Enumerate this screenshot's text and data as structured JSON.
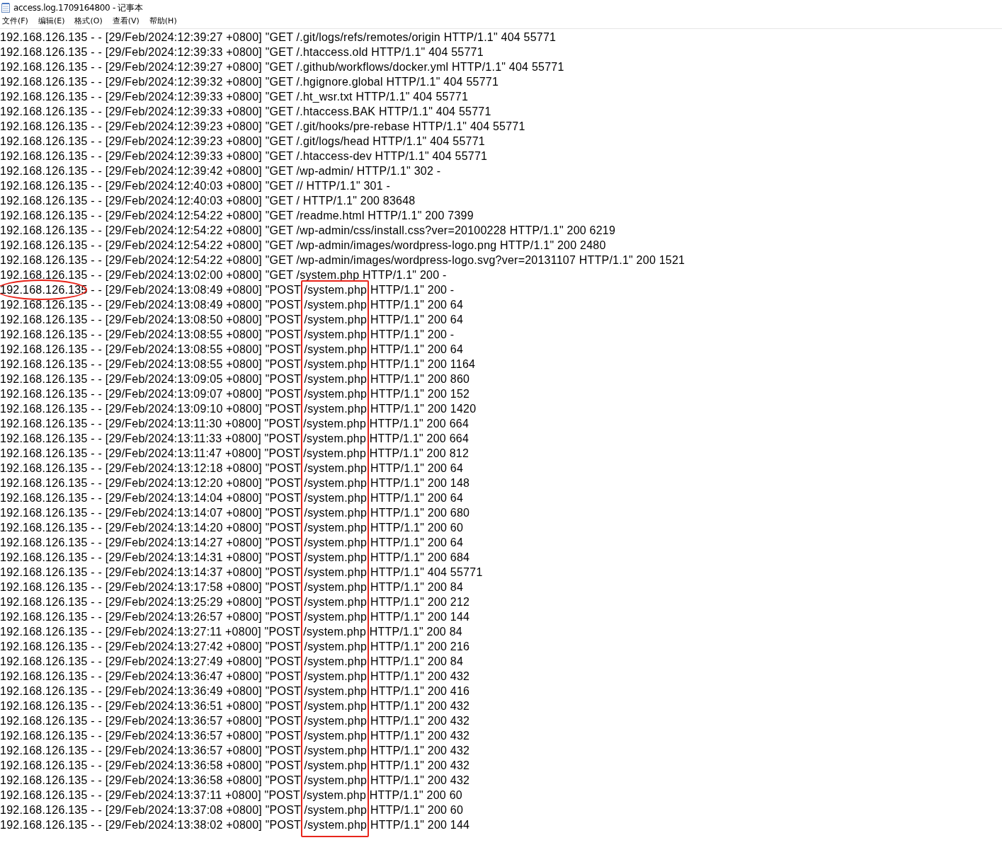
{
  "window": {
    "title": "access.log.1709164800 - 记事本"
  },
  "menu": [
    "文件(F)",
    "编辑(E)",
    "格式(O)",
    "查看(V)",
    "帮助(H)"
  ],
  "lines": [
    "192.168.126.135 - - [29/Feb/2024:12:39:27 +0800] \"GET /.git/logs/refs/remotes/origin HTTP/1.1\" 404 55771",
    "192.168.126.135 - - [29/Feb/2024:12:39:33 +0800] \"GET /.htaccess.old HTTP/1.1\" 404 55771",
    "192.168.126.135 - - [29/Feb/2024:12:39:27 +0800] \"GET /.github/workflows/docker.yml HTTP/1.1\" 404 55771",
    "192.168.126.135 - - [29/Feb/2024:12:39:32 +0800] \"GET /.hgignore.global HTTP/1.1\" 404 55771",
    "192.168.126.135 - - [29/Feb/2024:12:39:33 +0800] \"GET /.ht_wsr.txt HTTP/1.1\" 404 55771",
    "192.168.126.135 - - [29/Feb/2024:12:39:33 +0800] \"GET /.htaccess.BAK HTTP/1.1\" 404 55771",
    "192.168.126.135 - - [29/Feb/2024:12:39:23 +0800] \"GET /.git/hooks/pre-rebase HTTP/1.1\" 404 55771",
    "192.168.126.135 - - [29/Feb/2024:12:39:23 +0800] \"GET /.git/logs/head HTTP/1.1\" 404 55771",
    "192.168.126.135 - - [29/Feb/2024:12:39:33 +0800] \"GET /.htaccess-dev HTTP/1.1\" 404 55771",
    "192.168.126.135 - - [29/Feb/2024:12:39:42 +0800] \"GET /wp-admin/ HTTP/1.1\" 302 -",
    "192.168.126.135 - - [29/Feb/2024:12:40:03 +0800] \"GET // HTTP/1.1\" 301 -",
    "192.168.126.135 - - [29/Feb/2024:12:40:03 +0800] \"GET / HTTP/1.1\" 200 83648",
    "192.168.126.135 - - [29/Feb/2024:12:54:22 +0800] \"GET /readme.html HTTP/1.1\" 200 7399",
    "192.168.126.135 - - [29/Feb/2024:12:54:22 +0800] \"GET /wp-admin/css/install.css?ver=20100228 HTTP/1.1\" 200 6219",
    "192.168.126.135 - - [29/Feb/2024:12:54:22 +0800] \"GET /wp-admin/images/wordpress-logo.png HTTP/1.1\" 200 2480",
    "192.168.126.135 - - [29/Feb/2024:12:54:22 +0800] \"GET /wp-admin/images/wordpress-logo.svg?ver=20131107 HTTP/1.1\" 200 1521",
    "192.168.126.135 - - [29/Feb/2024:13:02:00 +0800] \"GET /system.php HTTP/1.1\" 200 -",
    "192.168.126.135 - - [29/Feb/2024:13:08:49 +0800] \"POST /system.php HTTP/1.1\" 200 -",
    "192.168.126.135 - - [29/Feb/2024:13:08:49 +0800] \"POST /system.php HTTP/1.1\" 200 64",
    "192.168.126.135 - - [29/Feb/2024:13:08:50 +0800] \"POST /system.php HTTP/1.1\" 200 64",
    "192.168.126.135 - - [29/Feb/2024:13:08:55 +0800] \"POST /system.php HTTP/1.1\" 200 -",
    "192.168.126.135 - - [29/Feb/2024:13:08:55 +0800] \"POST /system.php HTTP/1.1\" 200 64",
    "192.168.126.135 - - [29/Feb/2024:13:08:55 +0800] \"POST /system.php HTTP/1.1\" 200 1164",
    "192.168.126.135 - - [29/Feb/2024:13:09:05 +0800] \"POST /system.php HTTP/1.1\" 200 860",
    "192.168.126.135 - - [29/Feb/2024:13:09:07 +0800] \"POST /system.php HTTP/1.1\" 200 152",
    "192.168.126.135 - - [29/Feb/2024:13:09:10 +0800] \"POST /system.php HTTP/1.1\" 200 1420",
    "192.168.126.135 - - [29/Feb/2024:13:11:30 +0800] \"POST /system.php HTTP/1.1\" 200 664",
    "192.168.126.135 - - [29/Feb/2024:13:11:33 +0800] \"POST /system.php HTTP/1.1\" 200 664",
    "192.168.126.135 - - [29/Feb/2024:13:11:47 +0800] \"POST /system.php HTTP/1.1\" 200 812",
    "192.168.126.135 - - [29/Feb/2024:13:12:18 +0800] \"POST /system.php HTTP/1.1\" 200 64",
    "192.168.126.135 - - [29/Feb/2024:13:12:20 +0800] \"POST /system.php HTTP/1.1\" 200 148",
    "192.168.126.135 - - [29/Feb/2024:13:14:04 +0800] \"POST /system.php HTTP/1.1\" 200 64",
    "192.168.126.135 - - [29/Feb/2024:13:14:07 +0800] \"POST /system.php HTTP/1.1\" 200 680",
    "192.168.126.135 - - [29/Feb/2024:13:14:20 +0800] \"POST /system.php HTTP/1.1\" 200 60",
    "192.168.126.135 - - [29/Feb/2024:13:14:27 +0800] \"POST /system.php HTTP/1.1\" 200 64",
    "192.168.126.135 - - [29/Feb/2024:13:14:31 +0800] \"POST /system.php HTTP/1.1\" 200 684",
    "192.168.126.135 - - [29/Feb/2024:13:14:37 +0800] \"POST /system.php HTTP/1.1\" 404 55771",
    "192.168.126.135 - - [29/Feb/2024:13:17:58 +0800] \"POST /system.php HTTP/1.1\" 200 84",
    "192.168.126.135 - - [29/Feb/2024:13:25:29 +0800] \"POST /system.php HTTP/1.1\" 200 212",
    "192.168.126.135 - - [29/Feb/2024:13:26:57 +0800] \"POST /system.php HTTP/1.1\" 200 144",
    "192.168.126.135 - - [29/Feb/2024:13:27:11 +0800] \"POST /system.php HTTP/1.1\" 200 84",
    "192.168.126.135 - - [29/Feb/2024:13:27:42 +0800] \"POST /system.php HTTP/1.1\" 200 216",
    "192.168.126.135 - - [29/Feb/2024:13:27:49 +0800] \"POST /system.php HTTP/1.1\" 200 84",
    "192.168.126.135 - - [29/Feb/2024:13:36:47 +0800] \"POST /system.php HTTP/1.1\" 200 432",
    "192.168.126.135 - - [29/Feb/2024:13:36:49 +0800] \"POST /system.php HTTP/1.1\" 200 416",
    "192.168.126.135 - - [29/Feb/2024:13:36:51 +0800] \"POST /system.php HTTP/1.1\" 200 432",
    "192.168.126.135 - - [29/Feb/2024:13:36:57 +0800] \"POST /system.php HTTP/1.1\" 200 432",
    "192.168.126.135 - - [29/Feb/2024:13:36:57 +0800] \"POST /system.php HTTP/1.1\" 200 432",
    "192.168.126.135 - - [29/Feb/2024:13:36:57 +0800] \"POST /system.php HTTP/1.1\" 200 432",
    "192.168.126.135 - - [29/Feb/2024:13:36:58 +0800] \"POST /system.php HTTP/1.1\" 200 432",
    "192.168.126.135 - - [29/Feb/2024:13:36:58 +0800] \"POST /system.php HTTP/1.1\" 200 432",
    "192.168.126.135 - - [29/Feb/2024:13:37:11 +0800] \"POST /system.php HTTP/1.1\" 200 60",
    "192.168.126.135 - - [29/Feb/2024:13:37:08 +0800] \"POST /system.php HTTP/1.1\" 200 60",
    "192.168.126.135 - - [29/Feb/2024:13:38:02 +0800] \"POST /system.php HTTP/1.1\" 200 144"
  ],
  "circled_ip": {
    "color": "#e8261c"
  },
  "boxed_column": {
    "color": "#e8261c"
  }
}
